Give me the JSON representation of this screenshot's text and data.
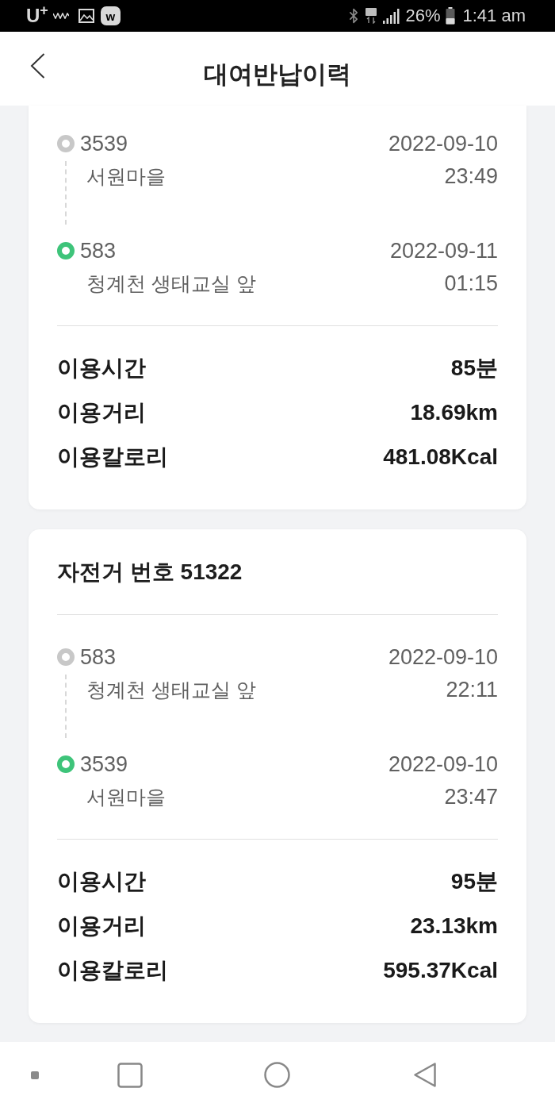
{
  "status_bar": {
    "carrier": "U$^{+}$",
    "app_badge": "w",
    "battery_percent": "26%",
    "time": "1:41 am"
  },
  "header": {
    "title": "대여반납이력"
  },
  "rides": [
    {
      "stations": [
        {
          "number": "3539",
          "date": "2022-09-10",
          "name": "서원마을",
          "time": "23:49",
          "color": "#c8c8c8"
        },
        {
          "number": "583",
          "date": "2022-09-11",
          "name": "청계천 생태교실 앞",
          "time": "01:15",
          "color": "#3ec47a"
        }
      ],
      "stats": [
        {
          "label": "이용시간",
          "value": "85분"
        },
        {
          "label": "이용거리",
          "value": "18.69km"
        },
        {
          "label": "이용칼로리",
          "value": "481.08Kcal"
        }
      ]
    },
    {
      "title": "자전거 번호 51322",
      "stations": [
        {
          "number": "583",
          "date": "2022-09-10",
          "name": "청계천 생태교실 앞",
          "time": "22:11",
          "color": "#c8c8c8"
        },
        {
          "number": "3539",
          "date": "2022-09-10",
          "name": "서원마을",
          "time": "23:47",
          "color": "#3ec47a"
        }
      ],
      "stats": [
        {
          "label": "이용시간",
          "value": "95분"
        },
        {
          "label": "이용거리",
          "value": "23.13km"
        },
        {
          "label": "이용칼로리",
          "value": "595.37Kcal"
        }
      ]
    }
  ]
}
